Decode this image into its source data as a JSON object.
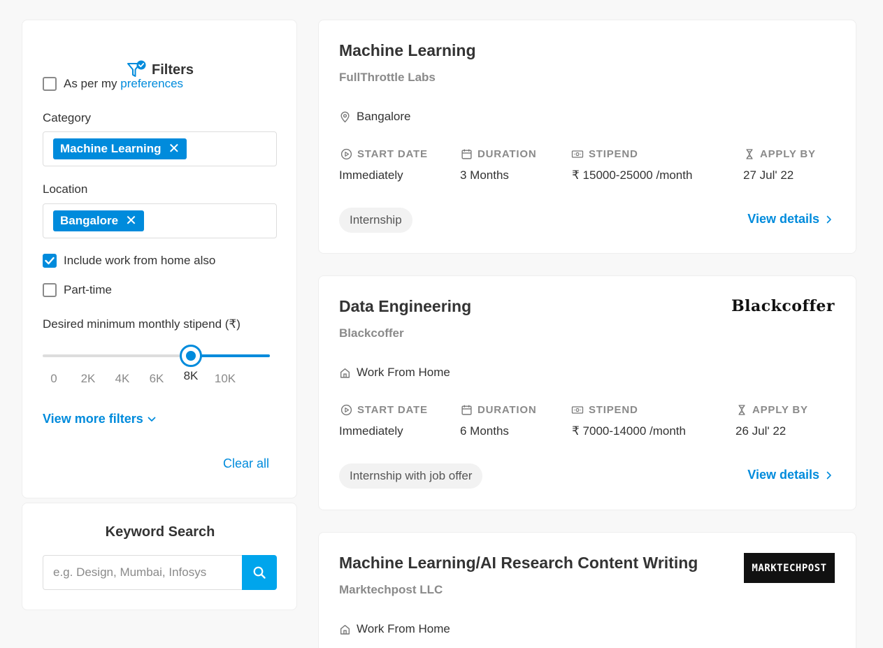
{
  "filters": {
    "title": "Filters",
    "preferences": {
      "prefix": "As per my",
      "link": "preferences",
      "checked": false
    },
    "category": {
      "label": "Category",
      "chip": "Machine Learning"
    },
    "location": {
      "label": "Location",
      "chip": "Bangalore"
    },
    "wfh": {
      "label": "Include work from home also",
      "checked": true
    },
    "parttime": {
      "label": "Part-time",
      "checked": false
    },
    "stipend": {
      "label": "Desired minimum monthly stipend (₹)",
      "ticks": [
        "0",
        "2K",
        "4K",
        "6K",
        "8K",
        "10K"
      ],
      "selected": "8K",
      "selected_value": 8000,
      "max_value": 10000
    },
    "more_filters": "View more filters",
    "clear_all": "Clear all"
  },
  "keyword": {
    "title": "Keyword Search",
    "placeholder": "e.g. Design, Mumbai, Infosys",
    "value": ""
  },
  "colors": {
    "accent": "#008bdc",
    "search_button": "#00a5ec",
    "muted": "#8a8a8a"
  },
  "meta_labels": {
    "start": "START DATE",
    "duration": "DURATION",
    "stipend": "STIPEND",
    "apply_by": "APPLY BY"
  },
  "jobs": [
    {
      "title": "Machine Learning",
      "company": "FullThrottle Labs",
      "location": "Bangalore",
      "location_icon": "map-pin-icon",
      "start": "Immediately",
      "duration": "3 Months",
      "stipend": "₹ 15000-25000 /month",
      "apply_by": "27 Jul' 22",
      "tag": "Internship",
      "view_details": "View details"
    },
    {
      "title": "Data Engineering",
      "company": "Blackcoffer",
      "logo": "Blackcoffer",
      "location": "Work From Home",
      "location_icon": "home-icon",
      "start": "Immediately",
      "duration": "6 Months",
      "stipend": "₹ 7000-14000 /month",
      "apply_by": "26 Jul' 22",
      "tag": "Internship with job offer",
      "view_details": "View details"
    },
    {
      "title": "Machine Learning/AI Research Content Writing",
      "company": "Marktechpost LLC",
      "logo": "MARKTECHPOST",
      "location": "Work From Home",
      "location_icon": "home-icon"
    }
  ]
}
